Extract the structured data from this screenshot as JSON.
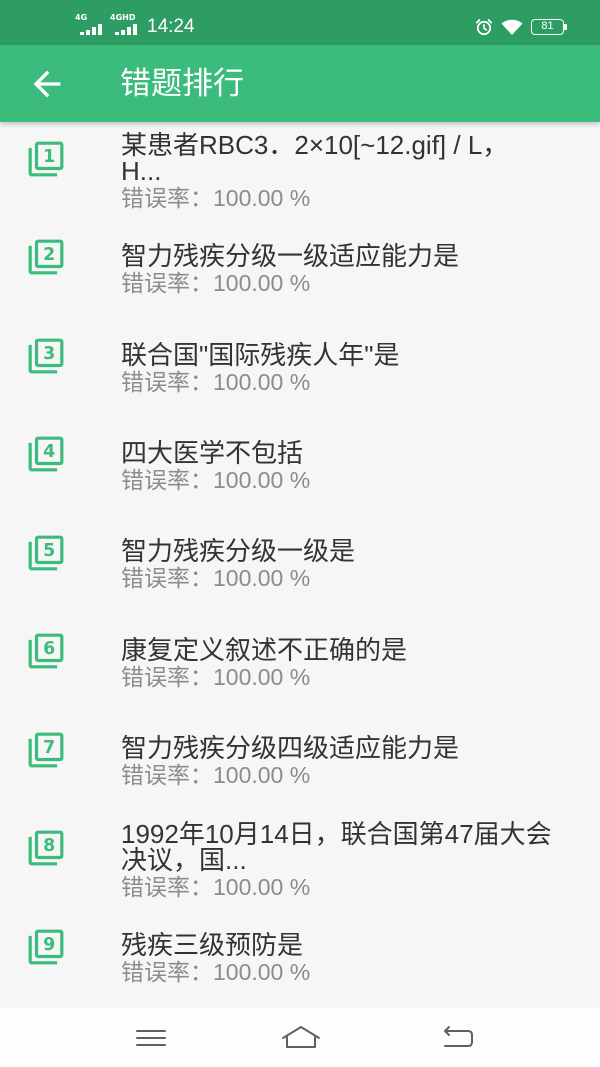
{
  "colors": {
    "status_bar": "#2e9d63",
    "primary": "#3cbc7c",
    "background": "#f6f6f6",
    "title_text": "#333333",
    "rate_text": "#8c8c8c",
    "nav_icon": "#606060"
  },
  "status_bar": {
    "sim1_network": "4G",
    "sim2_network": "4GHD",
    "time": "14:24",
    "battery_level": "81",
    "icons": [
      "signal-icon",
      "alarm-icon",
      "wifi-icon",
      "battery-icon"
    ]
  },
  "app_bar": {
    "back_icon": "arrow-back-icon",
    "title": "错题排行"
  },
  "items": [
    {
      "rank": "1",
      "title": "某患者RBC3．2×10[~12.gif] / L，\nH...",
      "error_rate": "错误率：100.00 %"
    },
    {
      "rank": "2",
      "title": "智力残疾分级一级适应能力是",
      "error_rate": "错误率：100.00 %"
    },
    {
      "rank": "3",
      "title": "联合国\"国际残疾人年\"是",
      "error_rate": "错误率：100.00 %"
    },
    {
      "rank": "4",
      "title": "四大医学不包括",
      "error_rate": "错误率：100.00 %"
    },
    {
      "rank": "5",
      "title": "智力残疾分级一级是",
      "error_rate": "错误率：100.00 %"
    },
    {
      "rank": "6",
      "title": "康复定义叙述不正确的是",
      "error_rate": "错误率：100.00 %"
    },
    {
      "rank": "7",
      "title": "智力残疾分级四级适应能力是",
      "error_rate": "错误率：100.00 %"
    },
    {
      "rank": "8",
      "title": "1992年10月14日，联合国第47届大会\n决议，国...",
      "error_rate": "错误率：100.00 %"
    },
    {
      "rank": "9",
      "title": "残疾三级预防是",
      "error_rate": "错误率：100.00 %"
    }
  ],
  "nav_bar": {
    "icons": [
      "menu-icon",
      "home-icon",
      "back-icon"
    ]
  }
}
